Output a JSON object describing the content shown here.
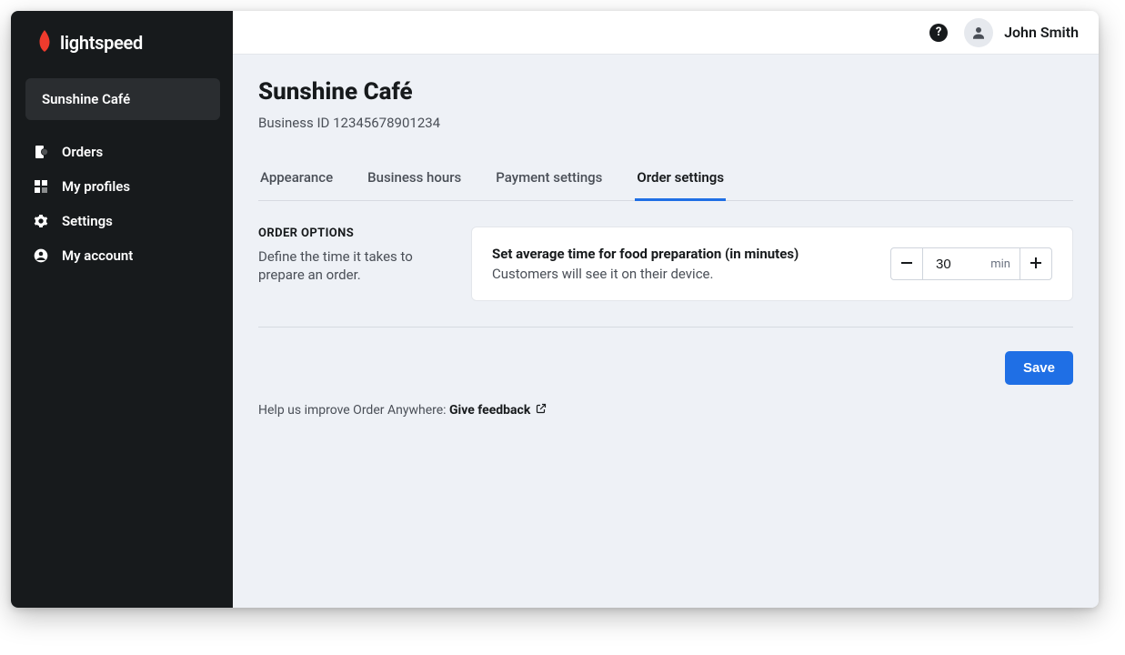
{
  "brand": {
    "name": "lightspeed"
  },
  "sidebar": {
    "business_name": "Sunshine Café",
    "items": [
      {
        "label": "Orders"
      },
      {
        "label": "My profiles"
      },
      {
        "label": "Settings"
      },
      {
        "label": "My account"
      }
    ]
  },
  "topbar": {
    "user_name": "John Smith"
  },
  "page": {
    "title": "Sunshine Café",
    "business_id_label": "Business ID 12345678901234"
  },
  "tabs": [
    {
      "label": "Appearance",
      "active": false
    },
    {
      "label": "Business hours",
      "active": false
    },
    {
      "label": "Payment settings",
      "active": false
    },
    {
      "label": "Order settings",
      "active": true
    }
  ],
  "order_options": {
    "section_title": "ORDER OPTIONS",
    "section_desc": "Define the time it takes to prepare an order.",
    "card_title": "Set average time for food preparation (in minutes)",
    "card_desc": "Customers will see it on their device.",
    "value": "30",
    "unit": "min"
  },
  "actions": {
    "save_label": "Save"
  },
  "feedback": {
    "prefix": "Help us improve Order Anywhere: ",
    "link_label": "Give feedback"
  }
}
